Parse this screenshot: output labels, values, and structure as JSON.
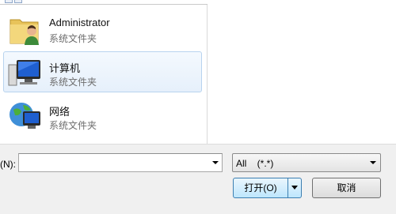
{
  "list": {
    "items": [
      {
        "name": "Administrator",
        "sub": "系统文件夹",
        "icon": "user-folder-icon"
      },
      {
        "name": "计算机",
        "sub": "系统文件夹",
        "icon": "computer-icon",
        "selected": true
      },
      {
        "name": "网络",
        "sub": "系统文件夹",
        "icon": "network-icon"
      }
    ]
  },
  "bottom": {
    "filename_label": "(N):",
    "filename_value": "",
    "filetype_value": "All    (*.*)",
    "open_label": "打开(O)",
    "cancel_label": "取消"
  },
  "colors": {
    "selection_bg": "#e6f0fb",
    "selection_border": "#b8d3ef",
    "default_button_border": "#3c7fb1"
  }
}
